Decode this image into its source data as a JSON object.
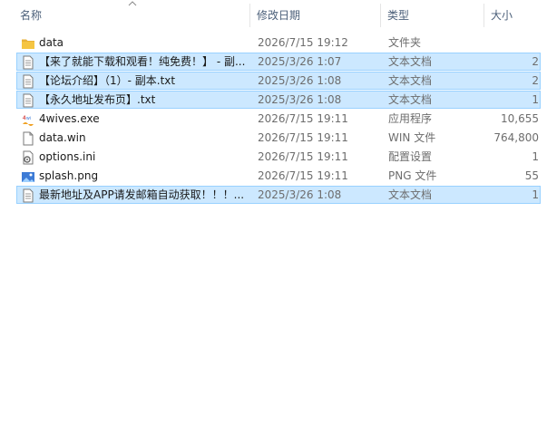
{
  "columns": {
    "name": "名称",
    "date": "修改日期",
    "type": "类型",
    "size": "大小"
  },
  "sort": {
    "column": "name",
    "direction": "ascending"
  },
  "colors": {
    "selection_bg": "#cce8ff",
    "selection_border": "#99d1ff",
    "header_text": "#4c607a",
    "folder": "#f5c542"
  },
  "files": [
    {
      "name": "data",
      "date": "2026/7/15 19:12",
      "type": "文件夹",
      "size": "",
      "icon": "folder-icon",
      "selected": false
    },
    {
      "name": "【来了就能下载和观看！纯免费！】 - 副...",
      "date": "2025/3/26 1:07",
      "type": "文本文档",
      "size": "2",
      "icon": "text-file-icon",
      "selected": true
    },
    {
      "name": "【论坛介绍】（1）- 副本.txt",
      "date": "2025/3/26 1:08",
      "type": "文本文档",
      "size": "2",
      "icon": "text-file-icon",
      "selected": true
    },
    {
      "name": "【永久地址发布页】.txt",
      "date": "2025/3/26 1:08",
      "type": "文本文档",
      "size": "1",
      "icon": "text-file-icon",
      "selected": true
    },
    {
      "name": "4wives.exe",
      "date": "2026/7/15 19:11",
      "type": "应用程序",
      "size": "10,655",
      "icon": "game-exe-icon",
      "selected": false
    },
    {
      "name": "data.win",
      "date": "2026/7/15 19:11",
      "type": "WIN 文件",
      "size": "764,800",
      "icon": "blank-file-icon",
      "selected": false
    },
    {
      "name": "options.ini",
      "date": "2026/7/15 19:11",
      "type": "配置设置",
      "size": "1",
      "icon": "settings-file-icon",
      "selected": false
    },
    {
      "name": "splash.png",
      "date": "2026/7/15 19:11",
      "type": "PNG 文件",
      "size": "55",
      "icon": "image-file-icon",
      "selected": false
    },
    {
      "name": "最新地址及APP请发邮箱自动获取！！！...",
      "date": "2025/3/26 1:08",
      "type": "文本文档",
      "size": "1",
      "icon": "text-file-icon",
      "selected": true
    }
  ]
}
